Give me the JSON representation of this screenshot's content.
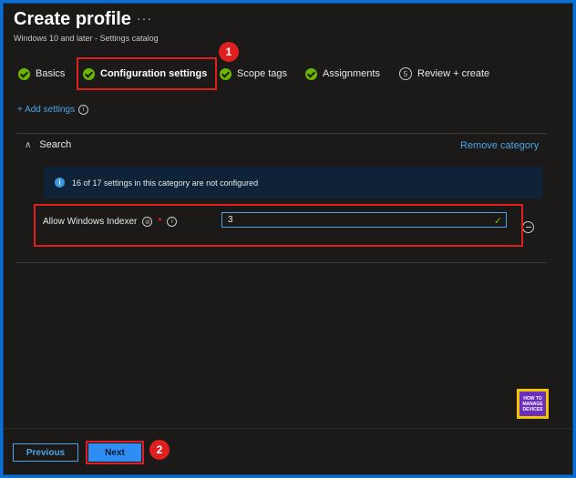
{
  "header": {
    "title": "Create profile",
    "more": "···",
    "subtitle": "Windows 10 and later - Settings catalog"
  },
  "steps": [
    {
      "label": "Basics",
      "state": "done"
    },
    {
      "label": "Configuration settings",
      "state": "active"
    },
    {
      "label": "Scope tags",
      "state": "done"
    },
    {
      "label": "Assignments",
      "state": "done"
    },
    {
      "label": "Review + create",
      "number": "5",
      "state": "pending"
    }
  ],
  "add_settings": "+ Add settings",
  "category": {
    "name": "Search",
    "remove_label": "Remove category",
    "banner": "16 of 17 settings in this category are not configured"
  },
  "setting": {
    "label": "Allow Windows Indexer",
    "required_mark": "*",
    "value": "3"
  },
  "footer": {
    "previous_label": "Previous",
    "next_label": "Next"
  },
  "annotations": {
    "badge1": "1",
    "badge2": "2"
  },
  "logo": {
    "line1": "HOW TO",
    "line2": "MANAGE",
    "line3": "DEVICES"
  },
  "colors": {
    "accent": "#4ba3e6",
    "success": "#6bb700",
    "highlight": "#e02020",
    "background": "#1b1a19"
  }
}
